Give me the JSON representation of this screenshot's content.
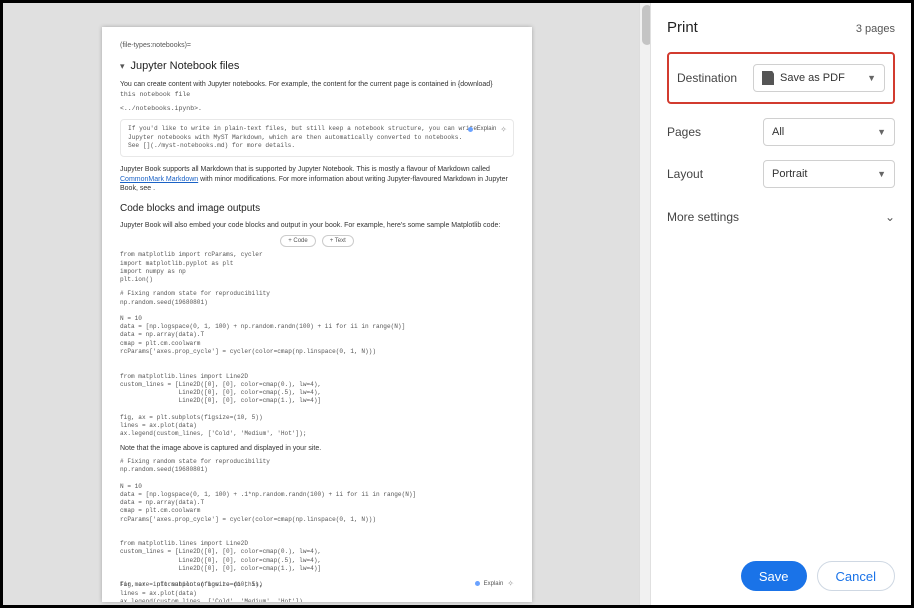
{
  "preview": {
    "breadcrumb": "(file-types:notebooks)=",
    "section_title": "Jupyter Notebook files",
    "intro_para": "You can create content with Jupyter notebooks. For example, the content for the current page is contained in {download}",
    "intro_code": "this notebook file",
    "intro_tail": "<../notebooks.ipynb>.",
    "notebox_lines": "If you'd like to write in plain-text files, but still keep a notebook structure, you can write\nJupyter notebooks with MyST Markdown, which are then automatically converted to notebooks.\nSee [](./myst-notebooks.md) for more details.",
    "explain_label": "Explain",
    "support_para_1": "Jupyter Book supports all Markdown that is supported by Jupyter Notebook. This is mostly a flavour of Markdown called ",
    "support_link": "CommonMark Markdown",
    "support_para_2": " with minor modifications. For more information about writing Jupyter-flavoured Markdown in Jupyter Book, see .",
    "subhead": "Code blocks and image outputs",
    "embed_para": "Jupyter Book will also embed your code blocks and output in your book. For example, here's some sample Matplotlib code:",
    "tab_code": "+ Code",
    "tab_text": "+ Text",
    "code1": "from matplotlib import rcParams, cycler\nimport matplotlib.pyplot as plt\nimport numpy as np\nplt.ion()",
    "code2": "# Fixing random state for reproducibility\nnp.random.seed(19680801)\n\nN = 10\ndata = [np.logspace(0, 1, 100) + np.random.randn(100) + ii for ii in range(N)]\ndata = np.array(data).T\ncmap = plt.cm.coolwarm\nrcParams['axes.prop_cycle'] = cycler(color=cmap(np.linspace(0, 1, N)))\n\n\nfrom matplotlib.lines import Line2D\ncustom_lines = [Line2D([0], [0], color=cmap(0.), lw=4),\n                Line2D([0], [0], color=cmap(.5), lw=4),\n                Line2D([0], [0], color=cmap(1.), lw=4)]\n\nfig, ax = plt.subplots(figsize=(10, 5))\nlines = ax.plot(data)\nax.legend(custom_lines, ['Cold', 'Medium', 'Hot']);",
    "note_para": "Note that the image above is captured and displayed in your site.",
    "code3": "# Fixing random state for reproducibility\nnp.random.seed(19680801)\n\nN = 10\ndata = [np.logspace(0, 1, 100) + .1*np.random.randn(100) + ii for ii in range(N)]\ndata = np.array(data).T\ncmap = plt.cm.coolwarm\nrcParams['axes.prop_cycle'] = cycler(color=cmap(np.linspace(0, 1, N)))\n\n\nfrom matplotlib.lines import Line2D\ncustom_lines = [Line2D([0], [0], color=cmap(0.), lw=4),\n                Line2D([0], [0], color=cmap(.5), lw=4),\n                Line2D([0], [0], color=cmap(1.), lw=4)]\n\nfig, ax = plt.subplots(figsize=(10, 5))\nlines = ax.plot(data)\nax.legend(custom_lines, ['Cold', 'Medium', 'Hot'])\nax.set(title=\"Smoother lines\")",
    "footer_left": "For more information on how to do this,"
  },
  "panel": {
    "title": "Print",
    "page_count": "3 pages",
    "destination_label": "Destination",
    "destination_value": "Save as PDF",
    "pages_label": "Pages",
    "pages_value": "All",
    "layout_label": "Layout",
    "layout_value": "Portrait",
    "more_label": "More settings",
    "save_label": "Save",
    "cancel_label": "Cancel"
  }
}
